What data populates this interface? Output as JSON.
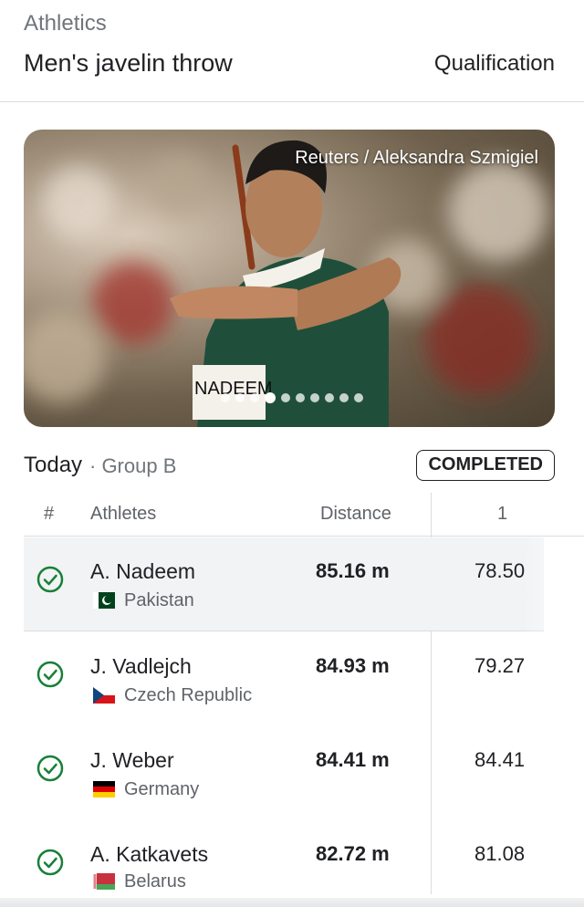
{
  "header": {
    "sport": "Athletics",
    "event": "Men's javelin throw",
    "phase": "Qualification"
  },
  "photo": {
    "credit": "Reuters / Aleksandra Szmigiel",
    "bib_text": "NADEEM",
    "slide_count": 10,
    "active_slide": 3
  },
  "session": {
    "day": "Today",
    "group": " · Group B",
    "status": "COMPLETED"
  },
  "table": {
    "headers": {
      "rank": "#",
      "athletes": "Athletes",
      "distance": "Distance",
      "attempt": "1"
    },
    "rows": [
      {
        "name": "A. Nadeem",
        "country": "Pakistan",
        "flag": "pakistan-flag",
        "distance": "85.16 m",
        "attempt1": "78.50",
        "qualified": true
      },
      {
        "name": "J. Vadlejch",
        "country": "Czech Republic",
        "flag": "czech-flag",
        "distance": "84.93 m",
        "attempt1": "79.27",
        "qualified": true
      },
      {
        "name": "J. Weber",
        "country": "Germany",
        "flag": "germany-flag",
        "distance": "84.41 m",
        "attempt1": "84.41",
        "qualified": true
      },
      {
        "name": "A. Katkavets",
        "country": "Belarus",
        "flag": "belarus-flag",
        "distance": "82.72 m",
        "attempt1": "81.08",
        "qualified": true
      }
    ]
  },
  "colors": {
    "qualified_green": "#188038",
    "highlight_row": "#f1f3f4",
    "secondary_text": "#5f6368"
  }
}
